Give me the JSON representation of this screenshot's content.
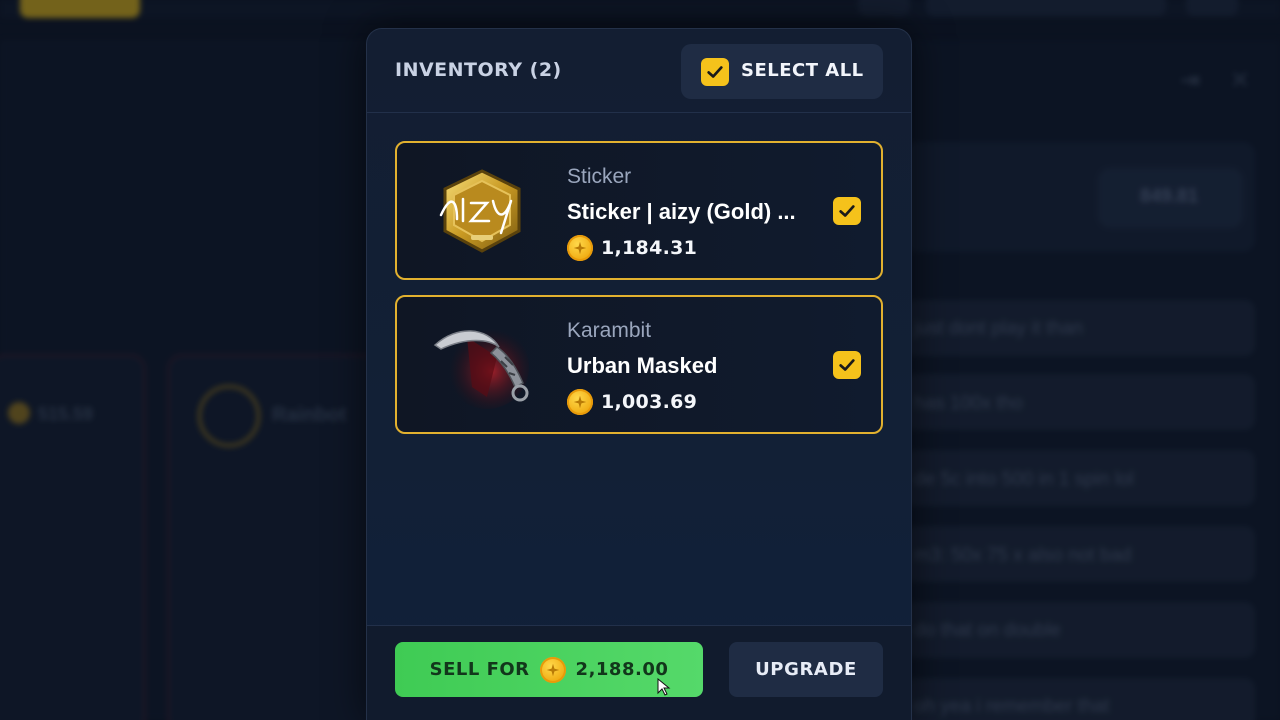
{
  "background": {
    "chat_lines": [
      "just dont play it than",
      "has 100x tho",
      "de 5c into 500 in 1 spin lol",
      "m3: 50x 75 x also not bad",
      "do that on double",
      "oh yea i remember that"
    ],
    "balance": "849.81",
    "left_card_label": "Rainbot",
    "left_card_value": "515.59"
  },
  "modal": {
    "title": "INVENTORY (2)",
    "select_all_label": "SELECT ALL",
    "items": [
      {
        "category": "Sticker",
        "name": "Sticker | aizy (Gold) ...",
        "price": "1,184.31",
        "selected": true,
        "icon": "gold-sticker-icon"
      },
      {
        "category": "Karambit",
        "name": "Urban Masked",
        "price": "1,003.69",
        "selected": true,
        "icon": "karambit-knife-icon"
      }
    ],
    "sell_label": "SELL FOR",
    "sell_value": "2,188.00",
    "upgrade_label": "UPGRADE"
  },
  "colors": {
    "accent_gold": "#f5c21b",
    "sell_green": "#4fd262",
    "card_border": "#e2b12f"
  }
}
